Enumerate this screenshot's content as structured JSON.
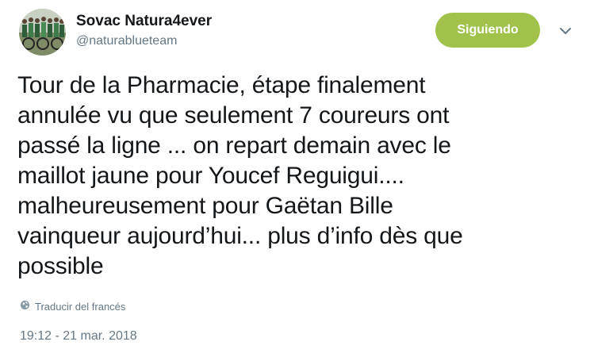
{
  "user": {
    "display_name": "Sovac Natura4ever",
    "screen_name": "@naturablueteam"
  },
  "follow_button": {
    "label": "Siguiendo"
  },
  "tweet": {
    "text": "Tour de la Pharmacie, étape finalement\nannulée vu que seulement 7 coureurs ont\npassé la ligne ... on repart demain avec le\nmaillot jaune pour Youcef Reguigui....\nmalheureusement pour Gaëtan Bille\nvainqueur aujourd’hui... plus d’info dès que\npossible",
    "translate_label": "Traducir del francés",
    "timestamp": "19:12 - 21 mar. 2018"
  },
  "icons": {
    "avatar": "team-photo-avatar",
    "caret": "chevron-down-icon",
    "translate": "globe-icon"
  },
  "colors": {
    "follow_button_bg": "#a0c14a",
    "text_primary": "#14171a",
    "text_secondary": "#657786"
  }
}
